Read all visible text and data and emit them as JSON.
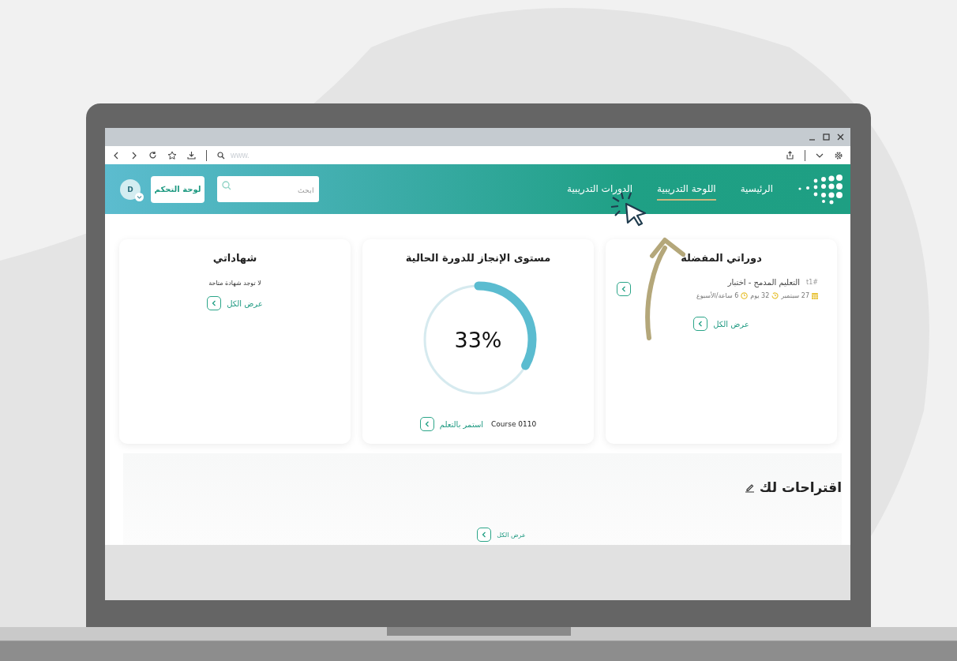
{
  "browser": {
    "address_placeholder": "www."
  },
  "header": {
    "nav": [
      {
        "label": "الرئيسية",
        "selected": false
      },
      {
        "label": "اللوحة التدريبية",
        "selected": true
      },
      {
        "label": "الدورات التدريبية",
        "selected": false
      }
    ],
    "search": {
      "placeholder": "ابحث"
    },
    "dashboard_button": "لوحة التحكم",
    "avatar": "D"
  },
  "favorites": {
    "title": "دوراتي المفضلة",
    "course": {
      "tag": "t1#",
      "title": "التعليم المدمج - اختبار",
      "date": "27 سبتمبر",
      "duration": "32 يوم",
      "hours": "6 ساعة/الأسبوع"
    },
    "view_all": "عرض الكل"
  },
  "progress": {
    "title": "مستوى الإنجاز للدورة الحالية",
    "level": 0.33,
    "reading": "33%",
    "course": "Course 0110",
    "continue": "استمر بالتعلم"
  },
  "certificates": {
    "title": "شهاداتي",
    "empty": "لا توجد شهادة متاحة",
    "view_all": "عرض الكل"
  },
  "suggestions": {
    "title": "اقتراحات لك",
    "view_all": "عرض الكل"
  }
}
